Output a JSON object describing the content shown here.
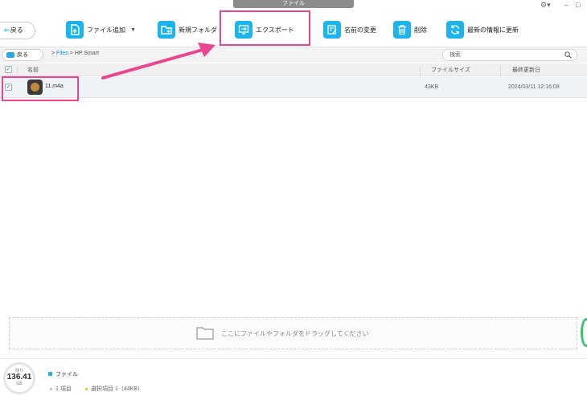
{
  "window": {
    "title": "ファイル"
  },
  "toolbar": {
    "back_label": "戻る",
    "add_file_label": "ファイル追加",
    "new_folder_label": "新規フォルダ",
    "export_label": "エクスポート",
    "rename_label": "名前の変更",
    "delete_label": "削除",
    "refresh_label": "最新の情報に更新"
  },
  "pathbar": {
    "back_label": "戻る",
    "crumb_root": "Files",
    "crumb_current": "HP Smart",
    "search_placeholder": "検索"
  },
  "table": {
    "headers": {
      "name": "名前",
      "size": "ファイルサイズ",
      "date": "最終更新日"
    },
    "rows": [
      {
        "name": "11.m4a",
        "size": "43KB",
        "date": "2024/03/11 12:16:08",
        "checked": true
      }
    ]
  },
  "dropzone": {
    "label": "ここにファイルやフォルダをドラッグしてください"
  },
  "footer": {
    "storage_prefix": "残り",
    "storage_value": "136.41",
    "storage_unit": "GB",
    "legend_label": "ファイル",
    "items_count": "1 項目",
    "selected": "選択項目 1（44KB）"
  },
  "colors": {
    "accent": "#1db3ec",
    "highlight": "#e9468f",
    "green": "#36c46b"
  }
}
